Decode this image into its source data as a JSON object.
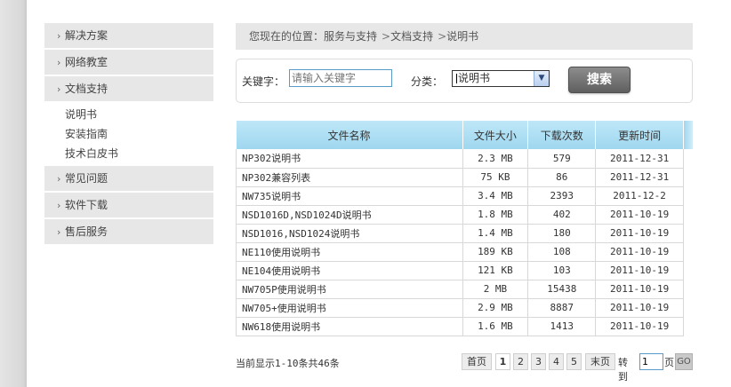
{
  "sidebar": {
    "items": [
      {
        "label": "解决方案"
      },
      {
        "label": "网络教室"
      },
      {
        "label": "文档支持"
      },
      {
        "label": "常见问题"
      },
      {
        "label": "软件下载"
      },
      {
        "label": "售后服务"
      }
    ],
    "sub_items": [
      {
        "label": "说明书"
      },
      {
        "label": "安装指南"
      },
      {
        "label": "技术白皮书"
      }
    ],
    "chevron": "›"
  },
  "breadcrumb": {
    "prefix": "您现在的位置：",
    "parts": [
      "服务与支持",
      "文档支持",
      "说明书"
    ],
    "sep": ">"
  },
  "search": {
    "keyword_label": "关键字：",
    "keyword_placeholder": "请输入关键字",
    "category_label": "分类：",
    "category_selected": "说明书",
    "button_label": "搜索"
  },
  "table": {
    "headers": [
      "文件名称",
      "文件大小",
      "下载次数",
      "更新时间"
    ],
    "rows": [
      {
        "name": "NP302说明书",
        "size": "2.3 MB",
        "downloads": "579",
        "date": "2011-12-31"
      },
      {
        "name": "NP302兼容列表",
        "size": "75 KB",
        "downloads": "86",
        "date": "2011-12-31"
      },
      {
        "name": "NW735说明书",
        "size": "3.4 MB",
        "downloads": "2393",
        "date": "2011-12-2"
      },
      {
        "name": "NSD1016D,NSD1024D说明书",
        "size": "1.8 MB",
        "downloads": "402",
        "date": "2011-10-19"
      },
      {
        "name": "NSD1016,NSD1024说明书",
        "size": "1.4 MB",
        "downloads": "180",
        "date": "2011-10-19"
      },
      {
        "name": "NE110使用说明书",
        "size": "189 KB",
        "downloads": "108",
        "date": "2011-10-19"
      },
      {
        "name": "NE104使用说明书",
        "size": "121 KB",
        "downloads": "103",
        "date": "2011-10-19"
      },
      {
        "name": "NW705P使用说明书",
        "size": "2 MB",
        "downloads": "15438",
        "date": "2011-10-19"
      },
      {
        "name": "NW705+使用说明书",
        "size": "2.9 MB",
        "downloads": "8887",
        "date": "2011-10-19"
      },
      {
        "name": "NW618使用说明书",
        "size": "1.6 MB",
        "downloads": "1413",
        "date": "2011-10-19"
      }
    ]
  },
  "footer": {
    "summary": "当前显示1-10条共46条",
    "first_label": "首页",
    "pages": [
      "1",
      "2",
      "3",
      "4",
      "5"
    ],
    "current_page": "1",
    "last_label": "末页",
    "goto_label": "转到",
    "goto_value": "1",
    "page_unit": "页",
    "go_label": "GO"
  },
  "colors": {
    "header_blue": "#a9dcf2",
    "sidebar_bg": "#e7e7e7",
    "search_button": "#6e6e6e"
  }
}
